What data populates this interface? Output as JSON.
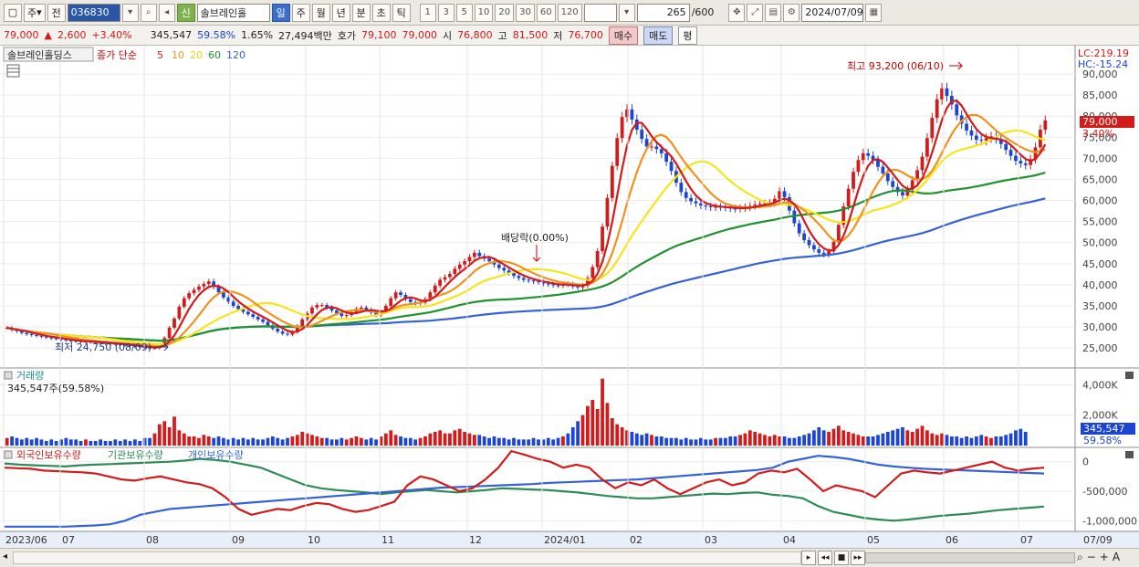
{
  "toolbar": {
    "period_label": "주",
    "prev_label": "전",
    "code": "036830",
    "credit_label": "신",
    "stock_name": "솔브레인홀",
    "periods": [
      "일",
      "주",
      "월",
      "년",
      "분",
      "초",
      "틱"
    ],
    "active_period": "일",
    "intervals": [
      "1",
      "3",
      "5",
      "10",
      "20",
      "30",
      "60",
      "120"
    ],
    "count": "265",
    "count_total": "/600",
    "date": "2024/07/09"
  },
  "quote": {
    "price": "79,000",
    "change": "2,600",
    "change_pct": "+3.40%",
    "volume": "345,547",
    "volume_ratio": "59.58%",
    "turnover": "1.65%",
    "amount": "27,494백만",
    "bid_label": "호가",
    "bid": "79,100",
    "ask": "79,000",
    "open_label": "시",
    "open": "76,800",
    "high_label": "고",
    "high": "81,500",
    "low_label": "저",
    "low": "76,700",
    "buy_label": "매수",
    "sell_label": "매도",
    "avg_label": "평"
  },
  "price_legend": {
    "name": "솔브레인홀딩스",
    "series": "종가 단순",
    "periods": [
      "5",
      "10",
      "20",
      "60",
      "120"
    ]
  },
  "lc_hc": {
    "lc": "LC:219.19",
    "hc": "HC:-15.24"
  },
  "current_price_tag": {
    "price": "79,000",
    "pct": "3.40%"
  },
  "annotations": {
    "high": "최고 93,200 (06/10)",
    "low": "최저 24,750 (08/09)",
    "dividend": "배당락(0.00%)"
  },
  "volume_legend": {
    "title": "거래량",
    "value": "345,547주(59.58%)"
  },
  "volume_tag": {
    "value": "345,547",
    "pct": "59.58%"
  },
  "holdings_legend": {
    "labels": [
      "외국인보유수량",
      "기관보유수량",
      "개인보유수량"
    ]
  },
  "colors": {
    "up": "#d21b1b",
    "down": "#1b45d2",
    "ma5": "#d21b1b",
    "ma10": "#f0921e",
    "ma20": "#f5e51a",
    "ma60": "#22922e",
    "ma120": "#3563d6",
    "foreign": "#d21b1b",
    "institution": "#2e8b57",
    "individual": "#3563d6"
  },
  "chart_data": [
    {
      "type": "candlestick",
      "title": "",
      "ylim": [
        22000,
        95000
      ],
      "y_ticks": [
        "25,000",
        "30,000",
        "35,000",
        "40,000",
        "45,000",
        "50,000",
        "55,000",
        "60,000",
        "65,000",
        "70,000",
        "75,000",
        "80,000",
        "85,000",
        "90,000"
      ],
      "x_ticks": [
        "2023/06",
        "07",
        "08",
        "09",
        "10",
        "11",
        "12",
        "2024/01",
        "02",
        "03",
        "04",
        "05",
        "06",
        "07",
        "07/09"
      ],
      "closes": [
        29800,
        29300,
        29000,
        28600,
        28300,
        28100,
        27900,
        27700,
        27500,
        27300,
        27200,
        27000,
        26800,
        26700,
        26600,
        26500,
        26500,
        26400,
        26300,
        26200,
        26100,
        26000,
        25900,
        25800,
        25700,
        25500,
        25400,
        25200,
        25100,
        25000,
        25000,
        25600,
        27400,
        29800,
        32000,
        34800,
        36800,
        38000,
        38800,
        39600,
        40200,
        40800,
        39500,
        38200,
        37000,
        36000,
        35000,
        34200,
        33600,
        33000,
        32400,
        31800,
        31200,
        30400,
        29600,
        28900,
        28400,
        28200,
        28800,
        30200,
        31800,
        33200,
        34600,
        35200,
        35200,
        34600,
        33900,
        33200,
        32600,
        32800,
        33500,
        34300,
        34600,
        34100,
        33400,
        32800,
        33600,
        35000,
        36800,
        38200,
        37600,
        36600,
        35900,
        35600,
        35800,
        36600,
        38200,
        39800,
        41200,
        41800,
        42600,
        43800,
        44800,
        45600,
        46600,
        47600,
        46800,
        46200,
        45600,
        44800,
        44000,
        43400,
        42800,
        42100,
        41600,
        41200,
        41000,
        40800,
        40600,
        40300,
        40100,
        39900,
        39800,
        40200,
        40100,
        39600,
        39400,
        39800,
        41600,
        44200,
        48000,
        53800,
        60600,
        68200,
        74800,
        79800,
        81600,
        79200,
        76800,
        74600,
        72800,
        72800,
        72200,
        71200,
        69200,
        67000,
        64200,
        62000,
        60600,
        59800,
        59300,
        58800,
        58600,
        58400,
        58500,
        58400,
        58300,
        58100,
        58000,
        58200,
        58400,
        58700,
        59000,
        59200,
        59300,
        59400,
        60400,
        62200,
        60800,
        57600,
        54600,
        52200,
        50600,
        49400,
        48400,
        47600,
        47200,
        47900,
        50200,
        54200,
        58600,
        62800,
        66800,
        69600,
        71200,
        70600,
        69600,
        68000,
        66400,
        64600,
        63200,
        62000,
        61200,
        62600,
        64800,
        67200,
        70400,
        74800,
        79600,
        84000,
        86600,
        84800,
        82800,
        80200,
        78200,
        76600,
        75400,
        74400,
        74200,
        74800,
        75200,
        74600,
        73400,
        72000,
        70600,
        69400,
        68800,
        68400,
        69800,
        72600,
        76800,
        79000
      ],
      "volumes": [
        0.5,
        0.6,
        0.5,
        0.4,
        0.5,
        0.4,
        0.5,
        0.4,
        0.3,
        0.4,
        0.3,
        0.4,
        0.5,
        0.4,
        0.4,
        0.3,
        0.4,
        0.3,
        0.3,
        0.4,
        0.3,
        0.3,
        0.4,
        0.3,
        0.4,
        0.3,
        0.4,
        0.3,
        0.5,
        0.5,
        0.8,
        1.4,
        1.6,
        1.2,
        1.9,
        1.0,
        0.8,
        0.6,
        0.6,
        0.5,
        0.7,
        0.6,
        0.5,
        0.6,
        0.5,
        0.4,
        0.5,
        0.4,
        0.5,
        0.4,
        0.5,
        0.4,
        0.4,
        0.5,
        0.6,
        0.5,
        0.4,
        0.5,
        0.6,
        0.7,
        0.9,
        0.8,
        0.7,
        0.6,
        0.5,
        0.5,
        0.4,
        0.4,
        0.5,
        0.4,
        0.5,
        0.6,
        0.5,
        0.4,
        0.5,
        0.4,
        0.6,
        0.8,
        1.0,
        0.7,
        0.6,
        0.5,
        0.5,
        0.4,
        0.5,
        0.6,
        0.8,
        0.9,
        1.0,
        0.8,
        0.8,
        1.0,
        1.1,
        0.9,
        0.8,
        0.7,
        0.7,
        0.6,
        0.5,
        0.6,
        0.5,
        0.5,
        0.4,
        0.5,
        0.4,
        0.4,
        0.4,
        0.5,
        0.4,
        0.4,
        0.5,
        0.4,
        0.5,
        0.6,
        0.8,
        1.2,
        1.6,
        2.0,
        2.6,
        3.0,
        2.4,
        4.4,
        2.8,
        1.8,
        1.4,
        1.2,
        1.0,
        0.9,
        0.8,
        0.7,
        0.8,
        0.7,
        0.6,
        0.6,
        0.5,
        0.5,
        0.5,
        0.4,
        0.5,
        0.4,
        0.4,
        0.5,
        0.4,
        0.4,
        0.5,
        0.5,
        0.5,
        0.6,
        0.6,
        0.7,
        0.8,
        1.0,
        0.9,
        0.8,
        0.7,
        0.6,
        0.7,
        0.6,
        0.6,
        0.5,
        0.5,
        0.6,
        0.7,
        0.8,
        1.0,
        1.2,
        1.0,
        0.9,
        1.1,
        1.3,
        1.0,
        0.9,
        0.8,
        0.7,
        0.6,
        0.6,
        0.6,
        0.7,
        0.8,
        0.9,
        1.0,
        1.1,
        1.2,
        1.0,
        0.9,
        1.1,
        1.3,
        1.0,
        0.8,
        0.7,
        0.8,
        0.7,
        0.6,
        0.6,
        0.5,
        0.6,
        0.5,
        0.6,
        0.7,
        0.6,
        0.5,
        0.6,
        0.6,
        0.7,
        0.8,
        1.0,
        1.1,
        0.9
      ],
      "volume_ticks": [
        "2,000K",
        "4,000K"
      ],
      "volume_ylim": [
        0,
        4800
      ],
      "holdings_ticks": [
        "0",
        "-500,000",
        "-1,000,000"
      ],
      "holdings_ylim": [
        -1150000,
        150000
      ],
      "foreign_holdings": [
        -100000,
        -110000,
        -120000,
        -150000,
        -160000,
        -170000,
        -180000,
        -200000,
        -250000,
        -300000,
        -320000,
        -280000,
        -250000,
        -300000,
        -350000,
        -380000,
        -450000,
        -600000,
        -800000,
        -900000,
        -850000,
        -800000,
        -820000,
        -750000,
        -700000,
        -720000,
        -800000,
        -850000,
        -820000,
        -750000,
        -680000,
        -400000,
        -250000,
        -300000,
        -400000,
        -500000,
        -450000,
        -300000,
        -100000,
        180000,
        120000,
        50000,
        0,
        -100000,
        -50000,
        -100000,
        -300000,
        -450000,
        -350000,
        -400000,
        -300000,
        -450000,
        -550000,
        -450000,
        -350000,
        -300000,
        -400000,
        -350000,
        -200000,
        -150000,
        -180000,
        -120000,
        -300000,
        -500000,
        -400000,
        -450000,
        -500000,
        -600000,
        -400000,
        -200000,
        -150000,
        -180000,
        -200000,
        -150000,
        -100000,
        -50000,
        0,
        -100000,
        -150000,
        -120000,
        -100000
      ],
      "institution_holdings": [
        -30000,
        -50000,
        -60000,
        -70000,
        -80000,
        -60000,
        -50000,
        -40000,
        -30000,
        -20000,
        -10000,
        0,
        20000,
        50000,
        30000,
        0,
        -50000,
        -100000,
        -200000,
        -300000,
        -400000,
        -450000,
        -480000,
        -500000,
        -520000,
        -550000,
        -520000,
        -500000,
        -480000,
        -500000,
        -520000,
        -500000,
        -480000,
        -450000,
        -460000,
        -470000,
        -480000,
        -500000,
        -520000,
        -550000,
        -580000,
        -600000,
        -620000,
        -620000,
        -600000,
        -580000,
        -560000,
        -540000,
        -550000,
        -530000,
        -520000,
        -560000,
        -580000,
        -620000,
        -750000,
        -850000,
        -900000,
        -950000,
        -980000,
        -1000000,
        -980000,
        -950000,
        -920000,
        -900000,
        -880000,
        -850000,
        -820000,
        -800000,
        -780000,
        -760000
      ],
      "individual_holdings": [
        -1100000,
        -1100000,
        -1100000,
        -1100000,
        -1100000,
        -1090000,
        -1080000,
        -1060000,
        -1000000,
        -900000,
        -850000,
        -800000,
        -780000,
        -760000,
        -740000,
        -720000,
        -700000,
        -680000,
        -660000,
        -640000,
        -620000,
        -600000,
        -580000,
        -560000,
        -540000,
        -520000,
        -500000,
        -480000,
        -460000,
        -440000,
        -430000,
        -420000,
        -410000,
        -400000,
        -390000,
        -380000,
        -360000,
        -350000,
        -340000,
        -330000,
        -320000,
        -310000,
        -300000,
        -280000,
        -260000,
        -240000,
        -220000,
        -200000,
        -180000,
        -160000,
        -140000,
        -100000,
        0,
        50000,
        100000,
        80000,
        50000,
        0,
        -50000,
        -80000,
        -100000,
        -120000,
        -130000,
        -140000,
        -150000,
        -160000,
        -170000,
        -180000,
        -190000,
        -200000
      ]
    }
  ]
}
